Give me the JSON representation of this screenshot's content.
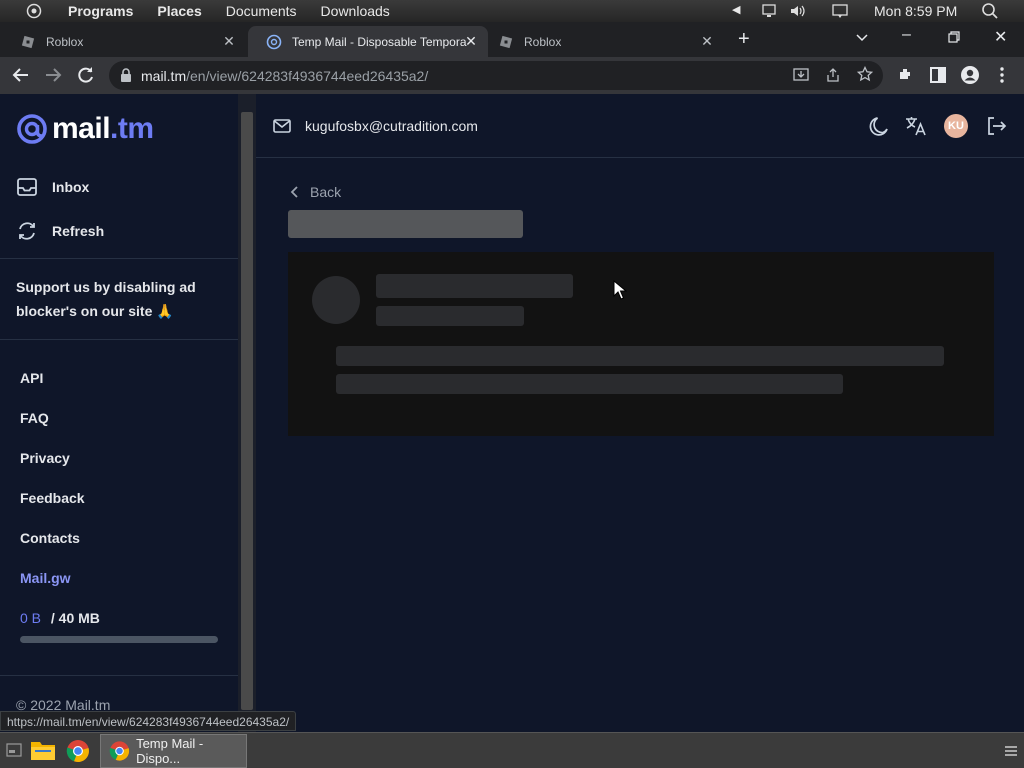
{
  "system_panel": {
    "menus": [
      "Programs",
      "Places",
      "Documents",
      "Downloads"
    ],
    "clock": "Mon 8:59 PM"
  },
  "tabs": [
    {
      "title": "Roblox",
      "active": false
    },
    {
      "title": "Temp Mail - Disposable Tempora",
      "active": true
    },
    {
      "title": "Roblox",
      "active": false
    }
  ],
  "omnibox": {
    "host": "mail.tm",
    "path": "/en/view/624283f4936744eed26435a2/"
  },
  "brand": {
    "name_prefix": "mail",
    "name_suffix": ".tm",
    "accent_color": "#6d7cf3"
  },
  "sidebar": {
    "inbox_label": "Inbox",
    "refresh_label": "Refresh",
    "support_text": "Support us by disabling ad blocker's on our site 🙏",
    "links": [
      "API",
      "FAQ",
      "Privacy",
      "Feedback",
      "Contacts",
      "Mail.gw"
    ],
    "storage_used": "0 B",
    "storage_total": "/ 40 MB",
    "storage_fraction": 0.0,
    "copyright": "© 2022 Mail.tm"
  },
  "header": {
    "email": "kugufosbx@cutradition.com",
    "avatar_initials": "KU"
  },
  "main": {
    "back_label": "Back"
  },
  "status_url": "https://mail.tm/en/view/624283f4936744eed26435a2/",
  "taskbar": {
    "active_window": "Temp Mail - Dispo..."
  }
}
